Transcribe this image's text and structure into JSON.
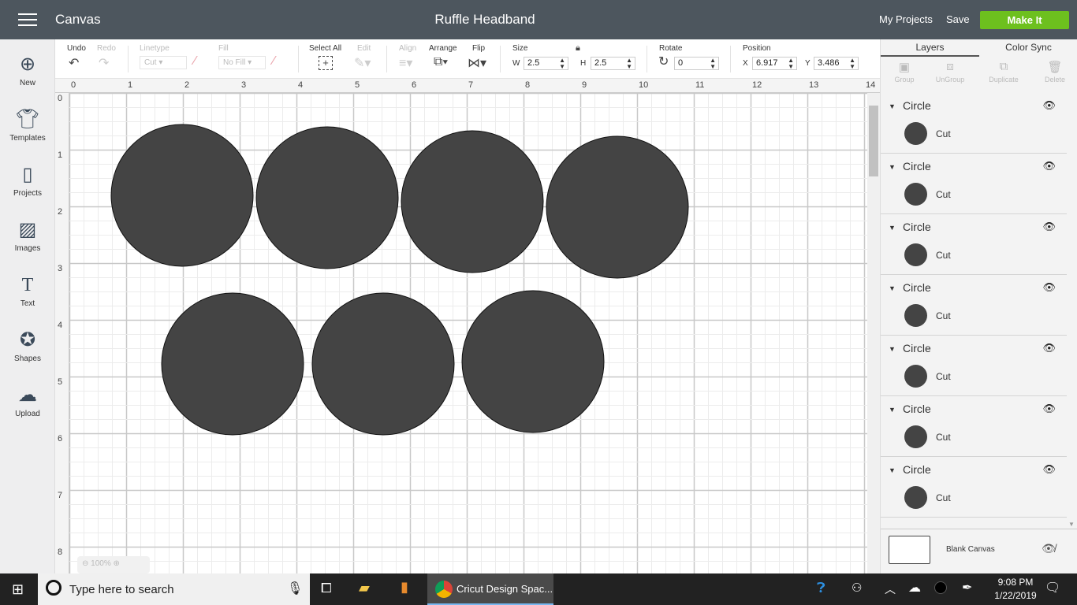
{
  "header": {
    "app_title": "Canvas",
    "project_title": "Ruffle Headband",
    "my_projects": "My Projects",
    "save": "Save",
    "make_it": "Make It",
    "make_it_color": "#6dc01e"
  },
  "sidebar": {
    "items": [
      {
        "label": "New",
        "icon": "plus-circle-icon"
      },
      {
        "label": "Templates",
        "icon": "tshirt-icon"
      },
      {
        "label": "Projects",
        "icon": "notebook-icon"
      },
      {
        "label": "Images",
        "icon": "image-icon"
      },
      {
        "label": "Text",
        "icon": "text-icon"
      },
      {
        "label": "Shapes",
        "icon": "shapes-icon"
      },
      {
        "label": "Upload",
        "icon": "upload-cloud-icon"
      }
    ]
  },
  "toolbar": {
    "undo": "Undo",
    "redo": "Redo",
    "linetype": "Linetype",
    "linetype_value": "Cut",
    "fill": "Fill",
    "fill_value": "No Fill",
    "select_all": "Select All",
    "edit": "Edit",
    "align": "Align",
    "arrange": "Arrange",
    "flip": "Flip",
    "size": "Size",
    "w_label": "W",
    "w_value": "2.5",
    "h_label": "H",
    "h_value": "2.5",
    "rotate": "Rotate",
    "rotate_value": "0",
    "position": "Position",
    "x_label": "X",
    "x_value": "6.917",
    "y_label": "Y",
    "y_value": "3.486"
  },
  "rulers": {
    "top": [
      "0",
      "1",
      "2",
      "3",
      "4",
      "5",
      "6",
      "7",
      "8",
      "9",
      "10",
      "11",
      "12",
      "13",
      "14"
    ],
    "left": [
      "0",
      "1",
      "2",
      "3",
      "4",
      "5",
      "6",
      "7",
      "8"
    ]
  },
  "canvas": {
    "zoom": "100%",
    "shape_color": "#444444",
    "circle_count": 7
  },
  "panel": {
    "tabs": [
      "Layers",
      "Color Sync"
    ],
    "tools": [
      "Group",
      "UnGroup",
      "Duplicate",
      "Delete"
    ],
    "layers": [
      {
        "name": "Circle",
        "op": "Cut"
      },
      {
        "name": "Circle",
        "op": "Cut"
      },
      {
        "name": "Circle",
        "op": "Cut"
      },
      {
        "name": "Circle",
        "op": "Cut"
      },
      {
        "name": "Circle",
        "op": "Cut"
      },
      {
        "name": "Circle",
        "op": "Cut"
      },
      {
        "name": "Circle",
        "op": "Cut"
      }
    ],
    "blank_canvas": "Blank Canvas"
  },
  "taskbar": {
    "search_placeholder": "Type here to search",
    "active_app": "Cricut Design Spac...",
    "time": "9:08 PM",
    "date": "1/22/2019"
  }
}
